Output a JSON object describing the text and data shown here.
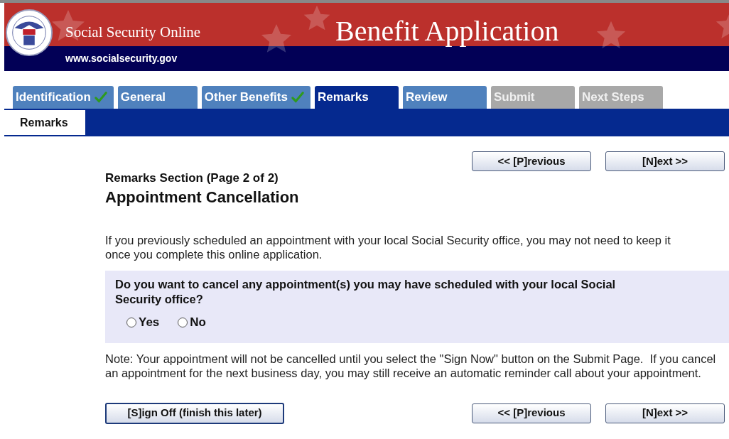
{
  "header": {
    "brand": "Social Security Online",
    "url": "www.socialsecurity.gov",
    "title": "Benefit Application"
  },
  "tabs": [
    {
      "label": "Identification",
      "done": true,
      "selected": false,
      "disabled": false
    },
    {
      "label": "General",
      "done": false,
      "selected": false,
      "disabled": false
    },
    {
      "label": "Other Benefits",
      "done": true,
      "selected": false,
      "disabled": false
    },
    {
      "label": "Remarks",
      "done": false,
      "selected": true,
      "disabled": false
    },
    {
      "label": "Review",
      "done": false,
      "selected": false,
      "disabled": false
    },
    {
      "label": "Submit",
      "done": false,
      "selected": false,
      "disabled": true
    },
    {
      "label": "Next Steps",
      "done": false,
      "selected": false,
      "disabled": true
    }
  ],
  "subtabs": [
    {
      "label": "Remarks",
      "selected": true
    }
  ],
  "top_buttons": [
    "<< [P]revious",
    "[N]ext >>"
  ],
  "section": "Remarks Section (Page 2 of 2)",
  "heading": "Appointment Cancellation",
  "intro": "If you previously scheduled an appointment with your local Social Security office, you may not need to keep it once you complete this online application.",
  "question": {
    "text": "Do you want to cancel any appointment(s) you may have scheduled with your local Social Security office?",
    "options": [
      {
        "label": "Yes",
        "selected": false
      },
      {
        "label": "No",
        "selected": false
      }
    ]
  },
  "note": "Note: Your appointment will not be cancelled until you select the \"Sign Now\" button on the Submit Page.  If you cancel an appointment for the next business day, you may still receive an automatic reminder call about your appointment.",
  "sign_off": "[S]ign Off (finish this later)",
  "bottom_buttons": [
    "<< [P]revious",
    "[N]ext >>"
  ]
}
